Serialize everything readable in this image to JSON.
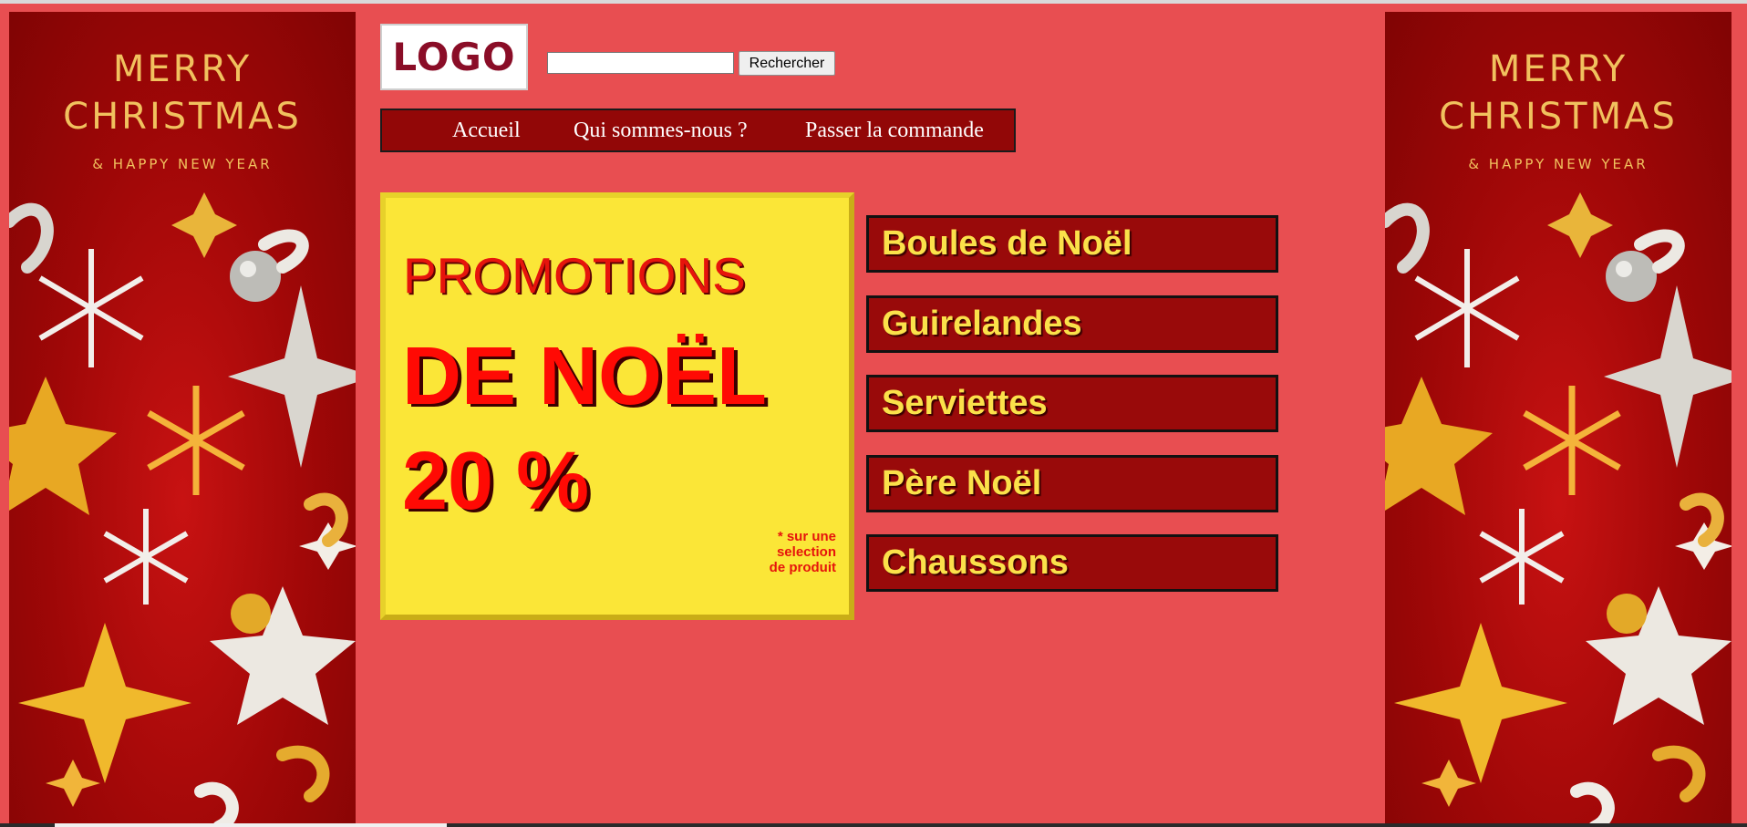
{
  "header": {
    "logo_text": "LOGO",
    "search": {
      "value": "",
      "placeholder": "",
      "button_label": "Rechercher"
    }
  },
  "nav": {
    "items": [
      {
        "label": "Accueil"
      },
      {
        "label": "Qui sommes-nous ?"
      },
      {
        "label": "Passer la commande"
      }
    ]
  },
  "banner": {
    "line1": "MERRY",
    "line2": "CHRISTMAS",
    "line3": "& HAPPY NEW YEAR"
  },
  "promo": {
    "title": "PROMOTIONS",
    "headline": "DE NOËL",
    "discount": "20 %",
    "note": [
      "* sur une",
      "selection",
      "de produit"
    ]
  },
  "categories": [
    {
      "label": "Boules de Noël"
    },
    {
      "label": "Guirelandes"
    },
    {
      "label": "Serviettes"
    },
    {
      "label": "Père Noël"
    },
    {
      "label": "Chaussons"
    }
  ],
  "colors": {
    "page_background": "#e84e51",
    "nav_background": "#920707",
    "promo_background": "#fbe637",
    "promo_text": "#ff0a04",
    "category_background": "#990a0a",
    "category_text": "#fbe14a",
    "banner_text": "#f1c15e"
  },
  "icons": [
    "star-icon",
    "snowflake-icon",
    "ornament-ball-icon",
    "ribbon-icon"
  ]
}
